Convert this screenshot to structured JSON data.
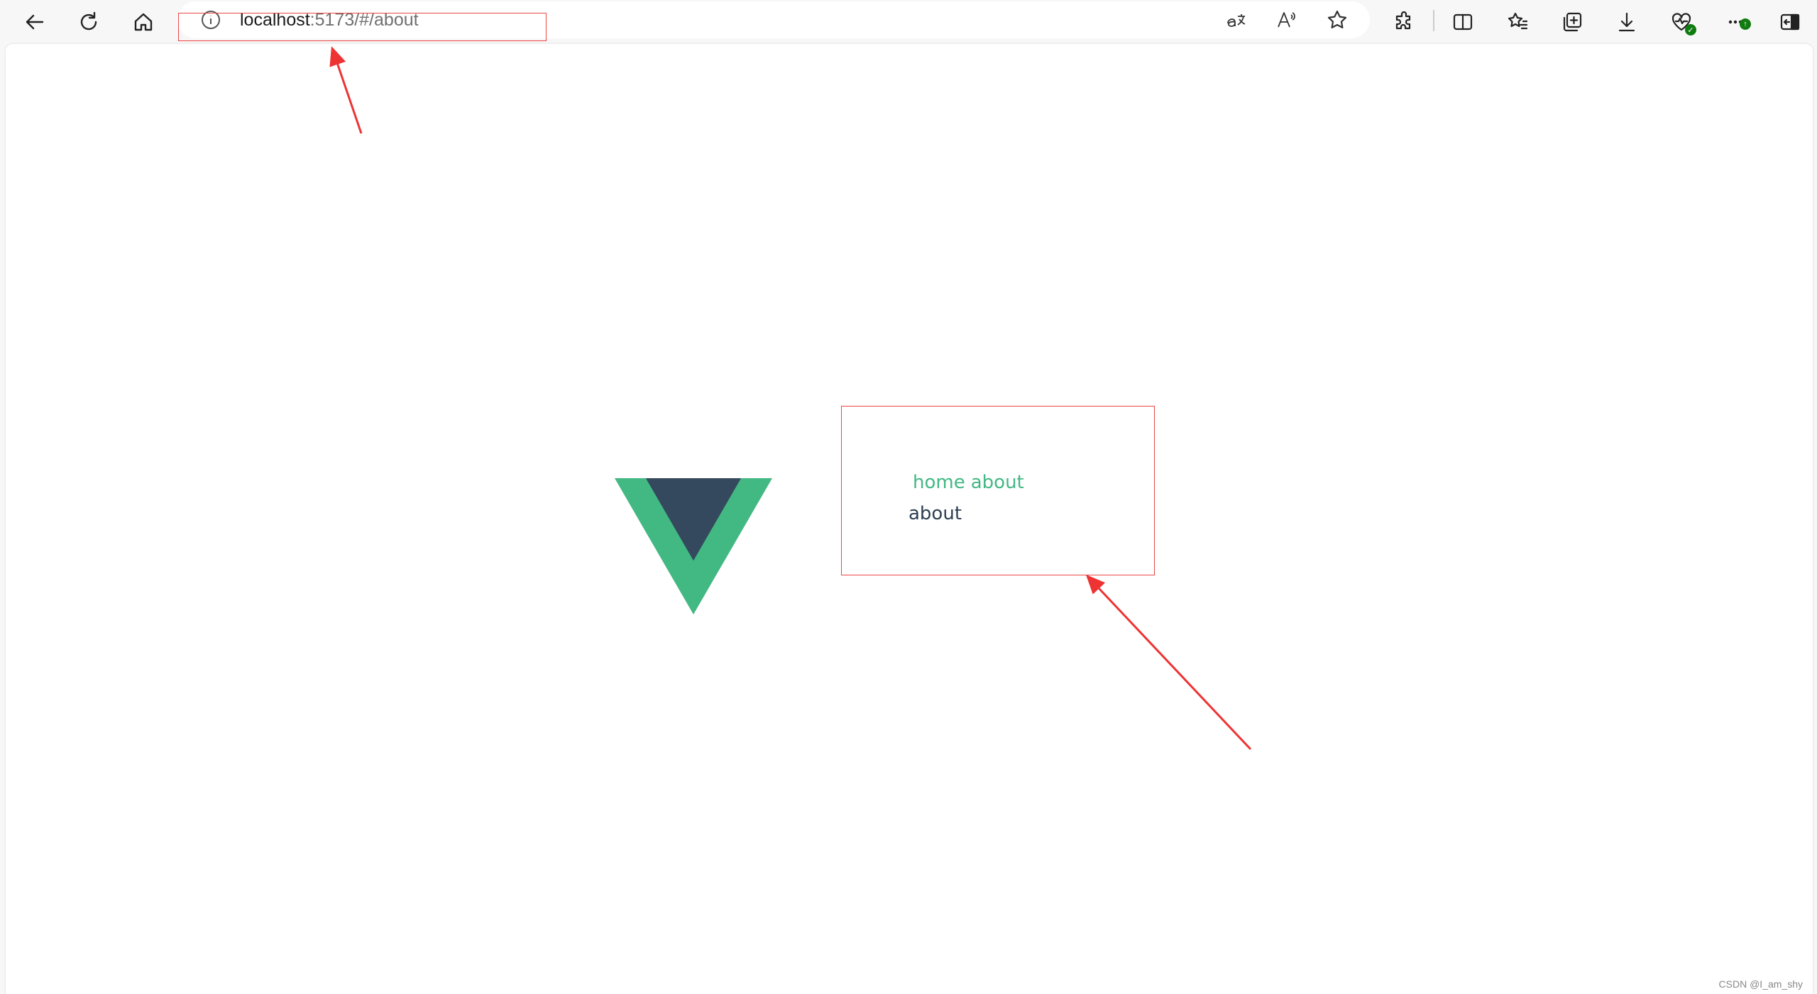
{
  "browser": {
    "url_host": "localhost",
    "url_path": ":5173/#/about",
    "badge_text": "↑",
    "colors": {
      "annotation": "#ee4444",
      "vue_green": "#42b883",
      "vue_dark": "#35495e"
    }
  },
  "app": {
    "nav": {
      "home_label": "home",
      "about_label": "about"
    },
    "page_text": "about"
  },
  "footer": {
    "watermark": "CSDN @I_am_shy"
  },
  "icons": {
    "back": "arrow-left-icon",
    "refresh": "refresh-icon",
    "home": "home-icon",
    "info": "info-icon",
    "translate": "translate-icon",
    "read_aloud": "read-aloud-icon",
    "favorite": "star-icon",
    "extensions": "puzzle-icon",
    "split": "split-screen-icon",
    "favorites_list": "favorites-icon",
    "collections": "collections-icon",
    "downloads": "download-icon",
    "health": "browser-essentials-icon",
    "more": "more-icon",
    "sidebar": "sidebar-icon"
  }
}
